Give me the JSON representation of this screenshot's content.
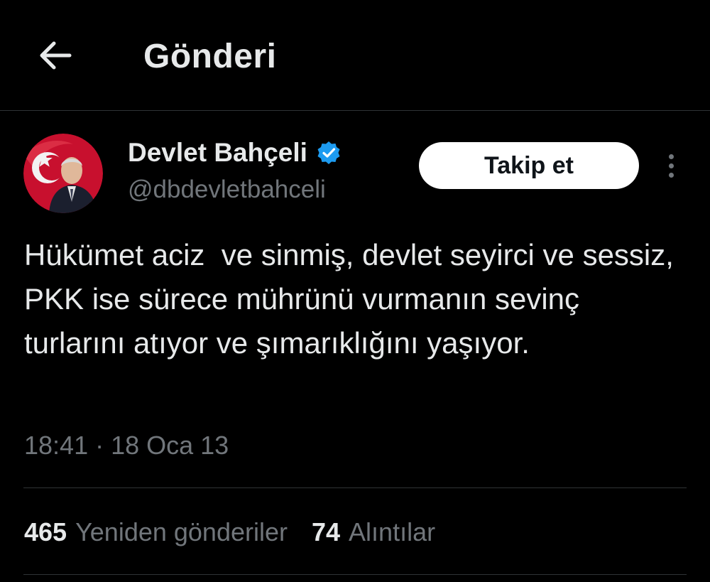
{
  "header": {
    "title": "Gönderi",
    "back_icon": "arrow-left-icon"
  },
  "author": {
    "name": "Devlet Bahçeli",
    "handle": "@dbdevletbahceli",
    "verified": true,
    "verified_color": "#1d9bf0",
    "avatar_bg_color": "#c8102e"
  },
  "actions": {
    "follow_label": "Takip et",
    "more_icon": "more-vertical-icon"
  },
  "tweet": {
    "text": "Hükümet aciz  ve sinmiş, devlet seyirci ve sessiz, PKK ise sürece mührünü vurmanın sevinç turlarını atıyor ve şımarıklığını yaşıyor.",
    "meta": "18:41 · 18 Oca 13"
  },
  "stats": {
    "reposts_count": "465",
    "reposts_label": "Yeniden gönderiler",
    "quotes_count": "74",
    "quotes_label": "Alıntılar"
  },
  "colors": {
    "background": "#000000",
    "text_primary": "#e7e9ea",
    "text_secondary": "#71767b",
    "divider": "#2f3336",
    "follow_bg": "#ffffff"
  }
}
